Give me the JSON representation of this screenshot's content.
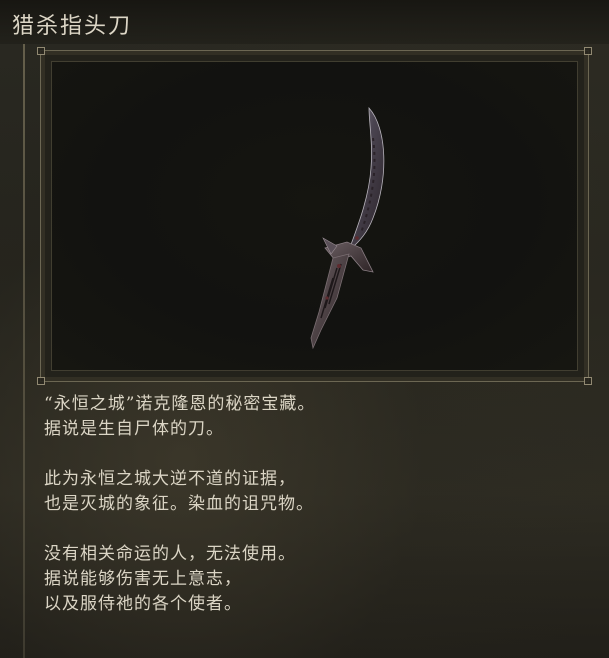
{
  "item": {
    "title": "猎杀指头刀",
    "image_icon": "curved-bone-dagger-icon"
  },
  "description": {
    "paragraphs": [
      [
        "“永恒之城”诺克隆恩的秘密宝藏。",
        "据说是生自尸体的刀。"
      ],
      [
        "此为永恒之城大逆不道的证据，",
        "也是灭城的象征。染血的诅咒物。"
      ],
      [
        "没有相关命运的人，无法使用。",
        "据说能够伤害无上意志，",
        "以及服侍祂的各个使者。"
      ]
    ]
  },
  "colors": {
    "text": "#dbd5c5",
    "frame": "#aaa082",
    "background": "#25241d"
  }
}
